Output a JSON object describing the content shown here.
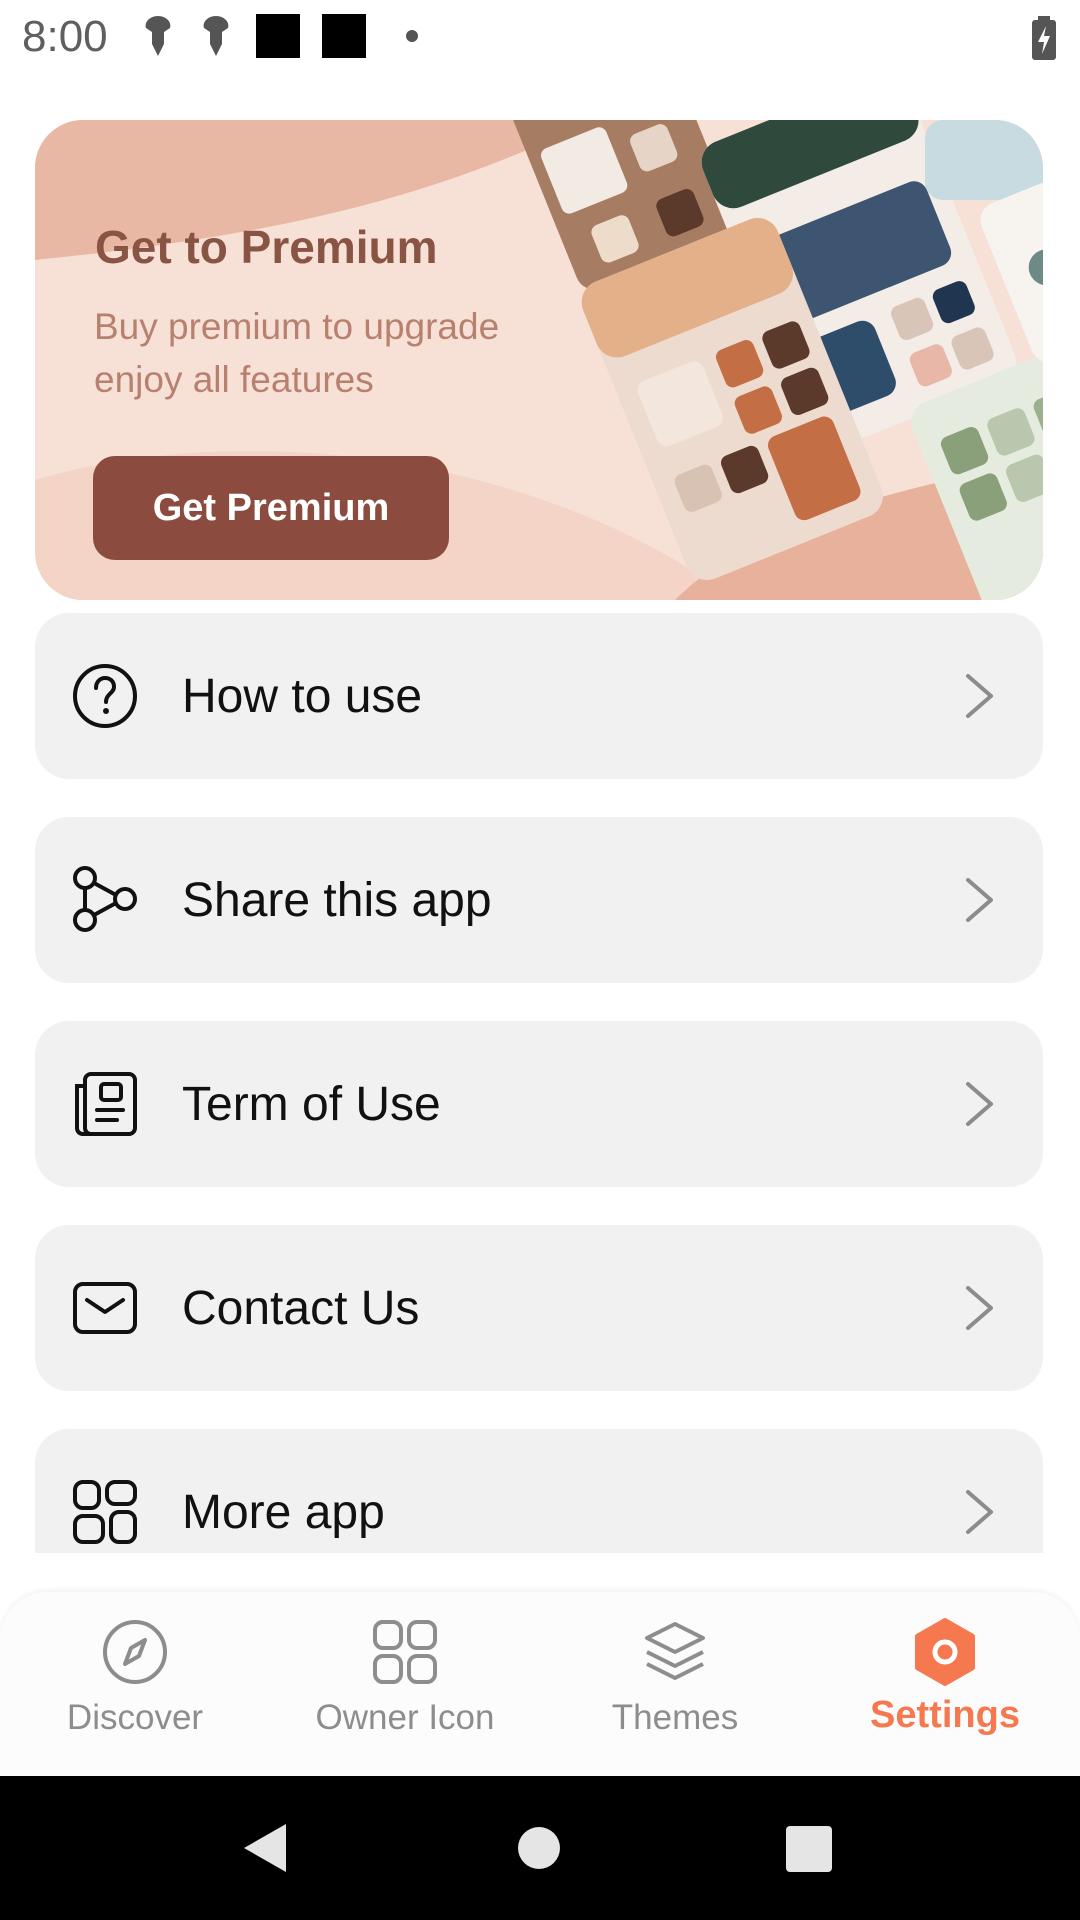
{
  "status_bar": {
    "time": "8:00"
  },
  "banner": {
    "title": "Get to Premium",
    "subtitle": "Buy premium to upgrade enjoy all features",
    "button_label": "Get Premium"
  },
  "menu": {
    "items": [
      {
        "label": "How to use",
        "icon": "help-circle-icon"
      },
      {
        "label": "Share this app",
        "icon": "share-icon"
      },
      {
        "label": "Term of Use",
        "icon": "document-icon"
      },
      {
        "label": "Contact Us",
        "icon": "mail-icon"
      },
      {
        "label": "More app",
        "icon": "apps-grid-icon"
      }
    ]
  },
  "bottom_nav": {
    "items": [
      {
        "label": "Discover",
        "icon": "compass-icon"
      },
      {
        "label": "Owner Icon",
        "icon": "grid-icon"
      },
      {
        "label": "Themes",
        "icon": "layers-icon"
      },
      {
        "label": "Settings",
        "icon": "settings-hex-icon",
        "active": true
      }
    ]
  },
  "colors": {
    "accent": "#f5784f",
    "banner_button": "#8b4c3f",
    "menu_background": "#f1f1f1"
  }
}
